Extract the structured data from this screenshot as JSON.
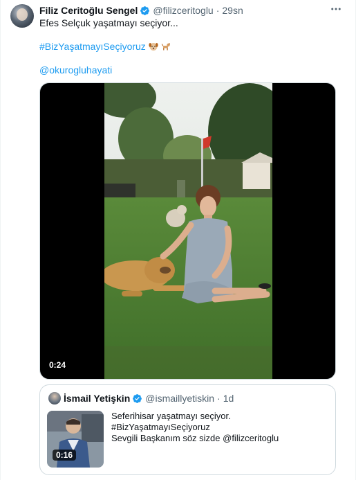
{
  "tweet": {
    "author_name": "Filiz Ceritoğlu Sengel",
    "handle": "@filizceritoglu",
    "separator": "·",
    "time": "29sn",
    "more_icon": "more-horizontal-icon",
    "text_line1": "Efes Selçuk yaşatmayı seçiyor...",
    "hashtag": "#BizYaşatmayıSeçiyoruz",
    "mention": "@okurogluhayati",
    "media": {
      "duration": "0:24"
    }
  },
  "quote": {
    "author_name": "İsmail Yetişkin",
    "handle": "@ismaillyetiskin",
    "separator": "·",
    "time": "1d",
    "line1": "Seferihisar yaşatmayı seçiyor.",
    "line2": "#BizYaşatmayıSeçiyoruz",
    "line3": "Sevgili Başkanım söz sizde @filizceritoglu",
    "media": {
      "duration": "0:16"
    }
  },
  "colors": {
    "accent": "#1d9bf0",
    "muted": "#536471",
    "border": "#cfd9de"
  }
}
